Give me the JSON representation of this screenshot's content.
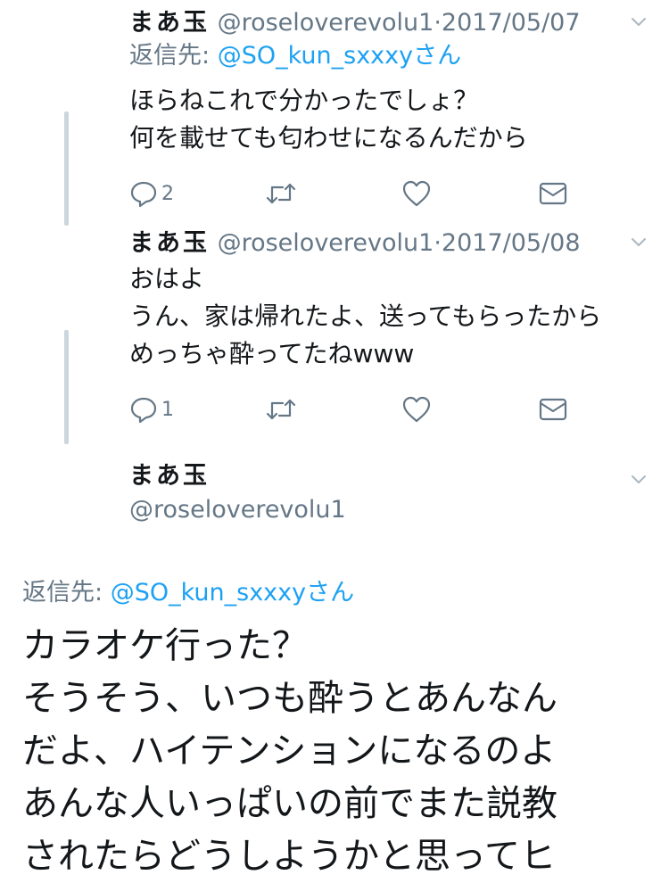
{
  "thread": [
    {
      "name": "まあ玉",
      "handle": "@roseloverevolu1",
      "separator": "·",
      "date": "2017/05/07",
      "reply_to_label": "返信先:",
      "reply_to_mention": "@SO_kun_sxxxyさん",
      "text_lines": [
        "ほらねこれで分かったでしょ？",
        "何を載せても匂わせになるんだから"
      ],
      "reply_count": "2"
    },
    {
      "name": "まあ玉",
      "handle": "@roseloverevolu1",
      "separator": "·",
      "date": "2017/05/08",
      "text_lines": [
        "おはよ",
        "うん、家は帰れたよ、送ってもらったから",
        "めっちゃ酔ってたねwww"
      ],
      "reply_count": "1"
    }
  ],
  "main_tweet": {
    "name": "まあ玉",
    "handle": "@roseloverevolu1",
    "reply_to_label": "返信先:",
    "reply_to_mention": "@SO_kun_sxxxyさん",
    "text_lines": [
      "カラオケ行った？",
      "そうそう、いつも酔うとあんなん",
      "だよ、ハイテンションになるのよ",
      "あんな人いっぱいの前でまた説教",
      "されたらどうしようかと思ってヒ"
    ]
  },
  "icons": {
    "reply": "reply-icon",
    "retweet": "retweet-icon",
    "like": "heart-icon",
    "dm": "envelope-icon",
    "menu": "chevron-down-icon"
  },
  "colors": {
    "text": "#14171a",
    "secondary": "#657786",
    "accent": "#1da1f2",
    "thread_line": "#ccd6dd"
  }
}
